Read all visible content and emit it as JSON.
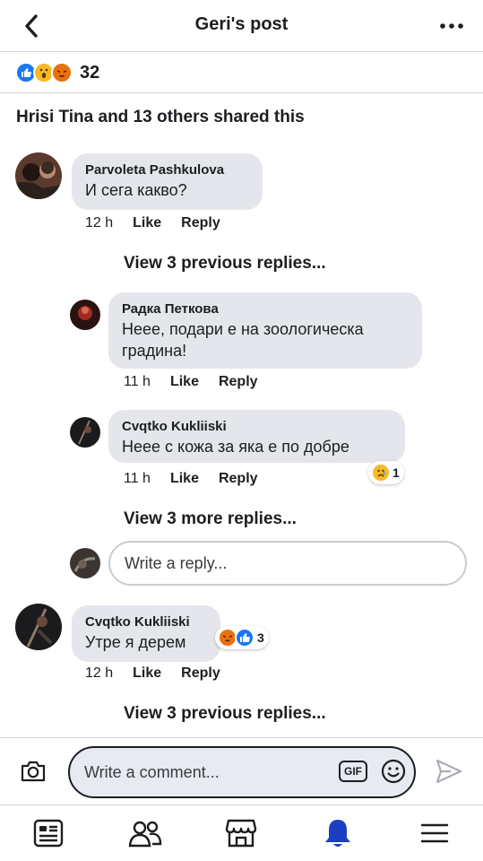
{
  "header": {
    "title": "Geri's post",
    "back_icon": "chevron-left-icon",
    "more_icon": "more-horizontal-icon"
  },
  "reactions": {
    "count": "32",
    "types": [
      "like",
      "wow",
      "angry"
    ]
  },
  "shared": {
    "text": "Hrisi Tina and 13 others shared this"
  },
  "comments": [
    {
      "author": "Parvoleta Pashkulova",
      "text": "И сега какво?",
      "time": "12 h",
      "like": "Like",
      "reply": "Reply"
    },
    {
      "view_previous": "View 3 previous replies..."
    },
    {
      "author": "Радка Петкова",
      "text": "Нeee, подари е на зоологическа градина!",
      "time": "11 h",
      "like": "Like",
      "reply": "Reply"
    },
    {
      "author": "Cvqtko Kukliiski",
      "text": "Нeee с кожа за яка е по добре",
      "time": "11 h",
      "like": "Like",
      "reply": "Reply",
      "reaction_count": "1"
    },
    {
      "view_more": "View 3 more replies..."
    },
    {
      "author": "Cvqtko Kukliiski",
      "text": "Утре я дерем",
      "time": "12 h",
      "like": "Like",
      "reply": "Reply",
      "reaction_count": "3"
    },
    {
      "view_previous": "View 3 previous replies..."
    }
  ],
  "reply_box": {
    "placeholder": "Write a reply..."
  },
  "composer": {
    "placeholder": "Write a comment...",
    "gif_label": "GIF"
  },
  "tabs": [
    "news-feed-icon",
    "friends-icon",
    "marketplace-icon",
    "notifications-icon",
    "menu-icon"
  ],
  "colors": {
    "brand": "#1877f2",
    "active_tab": "#1b3fc0",
    "bubble": "#e4e6eb"
  }
}
